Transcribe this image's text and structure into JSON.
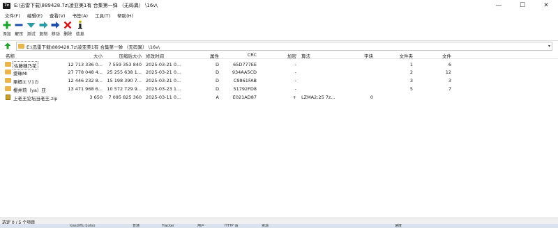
{
  "window": {
    "title": "E:\\迅雷下载\\889428.7z\\凌亚美1有 合集第一弹 （无码異） \\16v\\",
    "app_icon": "7z",
    "colors": {
      "folder": "#e8b64c",
      "add": "#1aa32a",
      "delete": "#d4161c",
      "test": "#2a9aa3",
      "move": "#1f4fa8"
    }
  },
  "window_controls": {
    "minimize": "—",
    "maximize": "☐",
    "close": "✕"
  },
  "menu": [
    "文件(F)",
    "编辑(E)",
    "查看(V)",
    "书签(A)",
    "工具(T)",
    "帮助(H)"
  ],
  "toolbar": [
    {
      "label": "添加",
      "icon": "add-icon"
    },
    {
      "label": "解压",
      "icon": "extract-icon"
    },
    {
      "label": "测试",
      "icon": "test-icon"
    },
    {
      "label": "复制",
      "icon": "copy-icon"
    },
    {
      "label": "移动",
      "icon": "move-icon"
    },
    {
      "label": "删除",
      "icon": "delete-icon"
    },
    {
      "label": "信息",
      "icon": "info-icon"
    }
  ],
  "address": {
    "path": "E:\\迅雷下载\\889428.7z\\凌亚美1有 合集第一弹 （无码異） \\16v\\"
  },
  "columns": [
    "名称",
    "大小",
    "压缩后大小",
    "修改时间",
    "属性",
    "CRC",
    "加密",
    "算法",
    "字块",
    "文件夹",
    "文件"
  ],
  "files": [
    {
      "name": "佐藤穗乃花",
      "size": "12 713 336 0...",
      "packed": "7 559 353 840",
      "modified": "2025-03-21 0...",
      "attr": "D",
      "crc": "65D777EE",
      "enc": "-",
      "method": "",
      "block": "",
      "folders": "1",
      "files": "6",
      "type": "folder"
    },
    {
      "name": "愛珠MI",
      "size": "27 778 048 4...",
      "packed": "25 255 638 1...",
      "modified": "2025-03-21 0...",
      "attr": "D",
      "crc": "934AA5CD",
      "enc": "-",
      "method": "",
      "block": "",
      "folders": "2",
      "files": "12",
      "type": "folder"
    },
    {
      "name": "栗栖エリ1カ",
      "size": "12 446 232 8...",
      "packed": "15 198 390 7...",
      "modified": "2025-03-21 0...",
      "attr": "D",
      "crc": "C9861FAB",
      "enc": "-",
      "method": "",
      "block": "",
      "folders": "3",
      "files": "3",
      "type": "folder"
    },
    {
      "name": "樱井莉（ya）亚",
      "size": "13 471 968 6...",
      "packed": "10 572 729 9...",
      "modified": "2025-03-23 1...",
      "attr": "D",
      "crc": "51792FD8",
      "enc": "-",
      "method": "",
      "block": "",
      "folders": "5",
      "files": "7",
      "type": "folder"
    },
    {
      "name": "上老王论坛当老王.zip",
      "size": "3 650",
      "packed": "7 095 825 360",
      "modified": "2025-03-11 0...",
      "attr": "A",
      "crc": "E021AD87",
      "enc": "+",
      "method": "LZMA2:25 7z...",
      "block": "0",
      "folders": "",
      "files": "",
      "type": "zip"
    }
  ],
  "status": {
    "text": "选定 0 / 5 个项目"
  },
  "taskbar": [
    "lossdiffu butso",
    "普通",
    "Tracker",
    "用户",
    "HTTP 请",
    "资源",
    "速度"
  ]
}
